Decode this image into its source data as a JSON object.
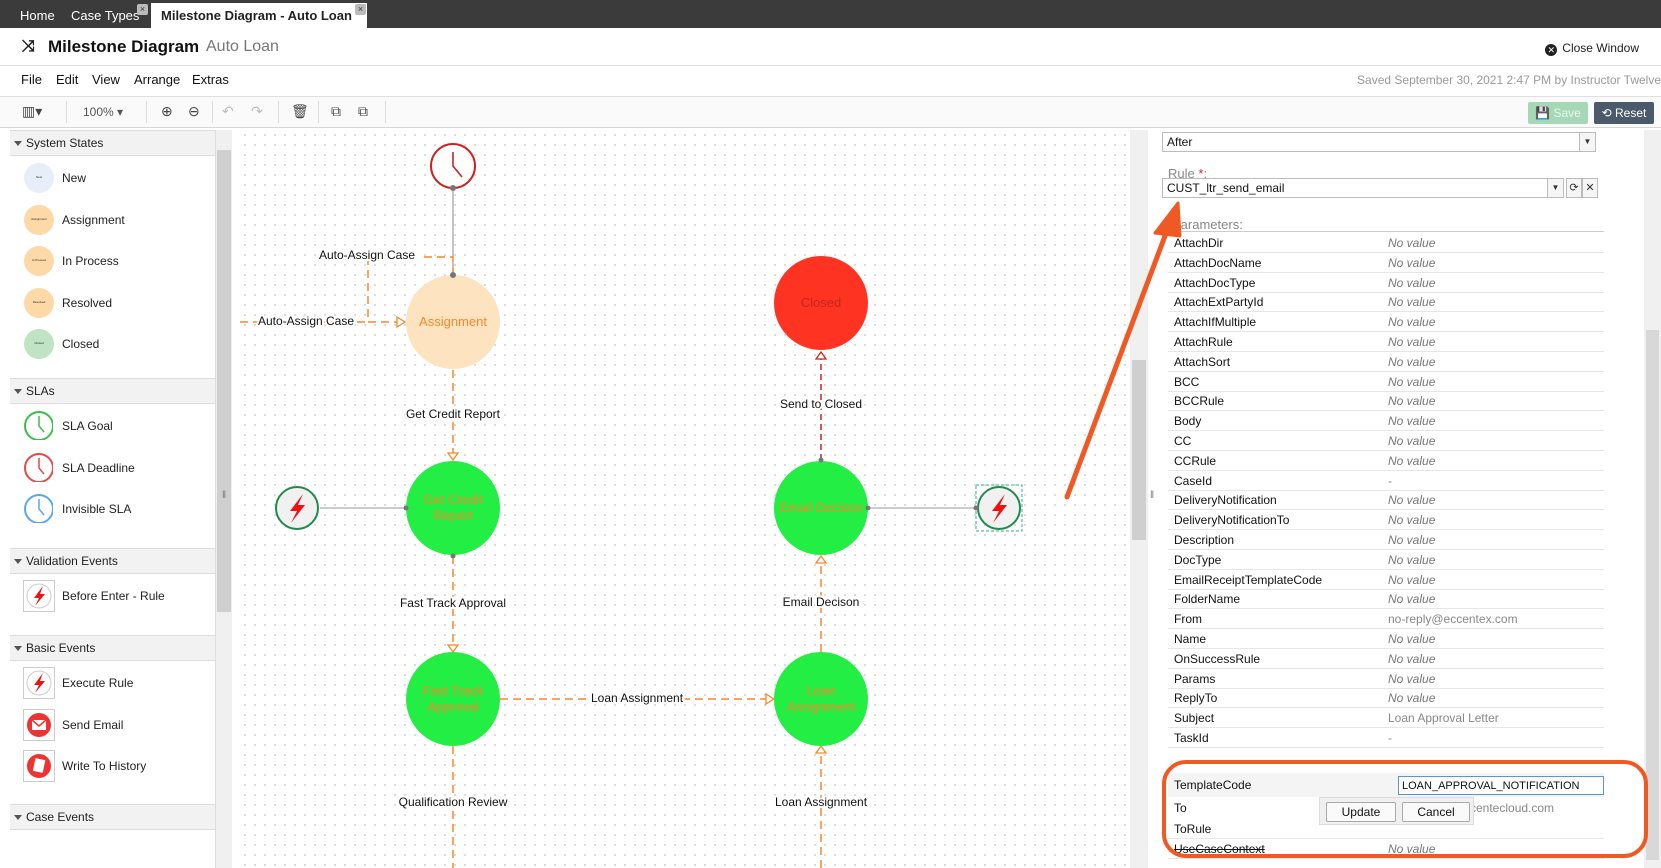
{
  "tabs": [
    {
      "label": "Home",
      "active": false,
      "closable": false
    },
    {
      "label": "Case Types",
      "active": false,
      "closable": true
    },
    {
      "label": "Milestone Diagram - Auto Loan",
      "active": true,
      "closable": true
    }
  ],
  "title": {
    "main": "Milestone Diagram",
    "sub": "Auto Loan",
    "icon": "shuffle-icon",
    "close_label": "Close Window"
  },
  "menu": {
    "items": [
      "File",
      "Edit",
      "View",
      "Arrange",
      "Extras"
    ],
    "saved_status": "Saved September 30, 2021 2:47 PM by Instructor Twelve"
  },
  "toolbar": {
    "zoom": "100%",
    "save_label": "Save",
    "reset_label": "Reset"
  },
  "palette": {
    "sections": [
      {
        "title": "System States",
        "items": [
          {
            "label": "New",
            "tiny": "New",
            "color": "#e8eef8"
          },
          {
            "label": "Assignment",
            "tiny": "Assignment",
            "color": "#fdd9a8"
          },
          {
            "label": "In Process",
            "tiny": "In Process",
            "color": "#fdd9a8"
          },
          {
            "label": "Resolved",
            "tiny": "Resolved",
            "color": "#fdd9a8"
          },
          {
            "label": "Closed",
            "tiny": "Closed",
            "color": "#bfe3c4"
          }
        ]
      },
      {
        "title": "SLAs",
        "items": [
          {
            "label": "SLA Goal",
            "color": "#3bbf4b"
          },
          {
            "label": "SLA Deadline",
            "color": "#e8474c"
          },
          {
            "label": "Invisible SLA",
            "color": "#5aa7e8"
          }
        ]
      },
      {
        "title": "Validation Events",
        "items": [
          {
            "label": "Before Enter - Rule"
          }
        ]
      },
      {
        "title": "Basic Events",
        "items": [
          {
            "label": "Execute Rule"
          },
          {
            "label": "Send Email"
          },
          {
            "label": "Write To History"
          }
        ]
      },
      {
        "title": "Case Events",
        "items": []
      }
    ]
  },
  "diagram": {
    "colors": {
      "orange": "#f5882a",
      "green": "#22ee44",
      "red": "#ff3322",
      "peach": "#fde3c0",
      "dashed_red": "#cc2222"
    },
    "nodes": {
      "assignment": "Assignment",
      "closed": "Closed",
      "get_credit_report": [
        "Get Credit",
        "Report"
      ],
      "email_decision": "Email Decison",
      "fast_track_approval": [
        "Fast Track",
        "Approval"
      ],
      "loan_assignment": [
        "Loan",
        "Assignment"
      ]
    },
    "edges": {
      "auto_assign_top": "Auto-Assign Case",
      "auto_assign_left": "Auto-Assign Case",
      "get_credit_report": "Get Credit Report",
      "fast_track_approval": "Fast Track Approval",
      "loan_assignment_h": "Loan Assignment",
      "qualification_review": "Qualification Review",
      "email_decision": "Email Decison",
      "send_to_closed": "Send to Closed",
      "loan_assignment_v": "Loan Assignment"
    }
  },
  "properties": {
    "timing_select": "After",
    "rule_label": "Rule",
    "rule_required": "*",
    "rule_value": "CUST_ltr_send_email",
    "params_label": "Parameters:",
    "params": [
      {
        "name": "AttachDir",
        "value": "No value",
        "empty": true
      },
      {
        "name": "AttachDocName",
        "value": "No value",
        "empty": true
      },
      {
        "name": "AttachDocType",
        "value": "No value",
        "empty": true
      },
      {
        "name": "AttachExtPartyId",
        "value": "No value",
        "empty": true
      },
      {
        "name": "AttachIfMultiple",
        "value": "No value",
        "empty": true
      },
      {
        "name": "AttachRule",
        "value": "No value",
        "empty": true
      },
      {
        "name": "AttachSort",
        "value": "No value",
        "empty": true
      },
      {
        "name": "BCC",
        "value": "No value",
        "empty": true
      },
      {
        "name": "BCCRule",
        "value": "No value",
        "empty": true
      },
      {
        "name": "Body",
        "value": "No value",
        "empty": true
      },
      {
        "name": "CC",
        "value": "No value",
        "empty": true
      },
      {
        "name": "CCRule",
        "value": "No value",
        "empty": true
      },
      {
        "name": "CaseId",
        "value": "-",
        "empty": false
      },
      {
        "name": "DeliveryNotification",
        "value": "No value",
        "empty": true
      },
      {
        "name": "DeliveryNotificationTo",
        "value": "No value",
        "empty": true
      },
      {
        "name": "Description",
        "value": "No value",
        "empty": true
      },
      {
        "name": "DocType",
        "value": "No value",
        "empty": true
      },
      {
        "name": "EmailReceiptTemplateCode",
        "value": "No value",
        "empty": true
      },
      {
        "name": "FolderName",
        "value": "No value",
        "empty": true
      },
      {
        "name": "From",
        "value": "no-reply@eccentex.com",
        "empty": false
      },
      {
        "name": "Name",
        "value": "No value",
        "empty": true
      },
      {
        "name": "OnSuccessRule",
        "value": "No value",
        "empty": true
      },
      {
        "name": "Params",
        "value": "No value",
        "empty": true
      },
      {
        "name": "ReplyTo",
        "value": "No value",
        "empty": true
      },
      {
        "name": "Subject",
        "value": "Loan Approval Letter",
        "empty": false
      },
      {
        "name": "TaskId",
        "value": "-",
        "empty": false
      }
    ],
    "edit": {
      "name": "TemplateCode",
      "value": "LOAN_APPROVAL_NOTIFICATION",
      "to_label": "To",
      "to_value_partial": "ccentecloud.com",
      "torule_label": "ToRule",
      "usecase_label": "UseCaseContext",
      "usecase_value": "No value",
      "update_label": "Update",
      "cancel_label": "Cancel"
    }
  },
  "annotation": {
    "color": "#ef5a24"
  }
}
